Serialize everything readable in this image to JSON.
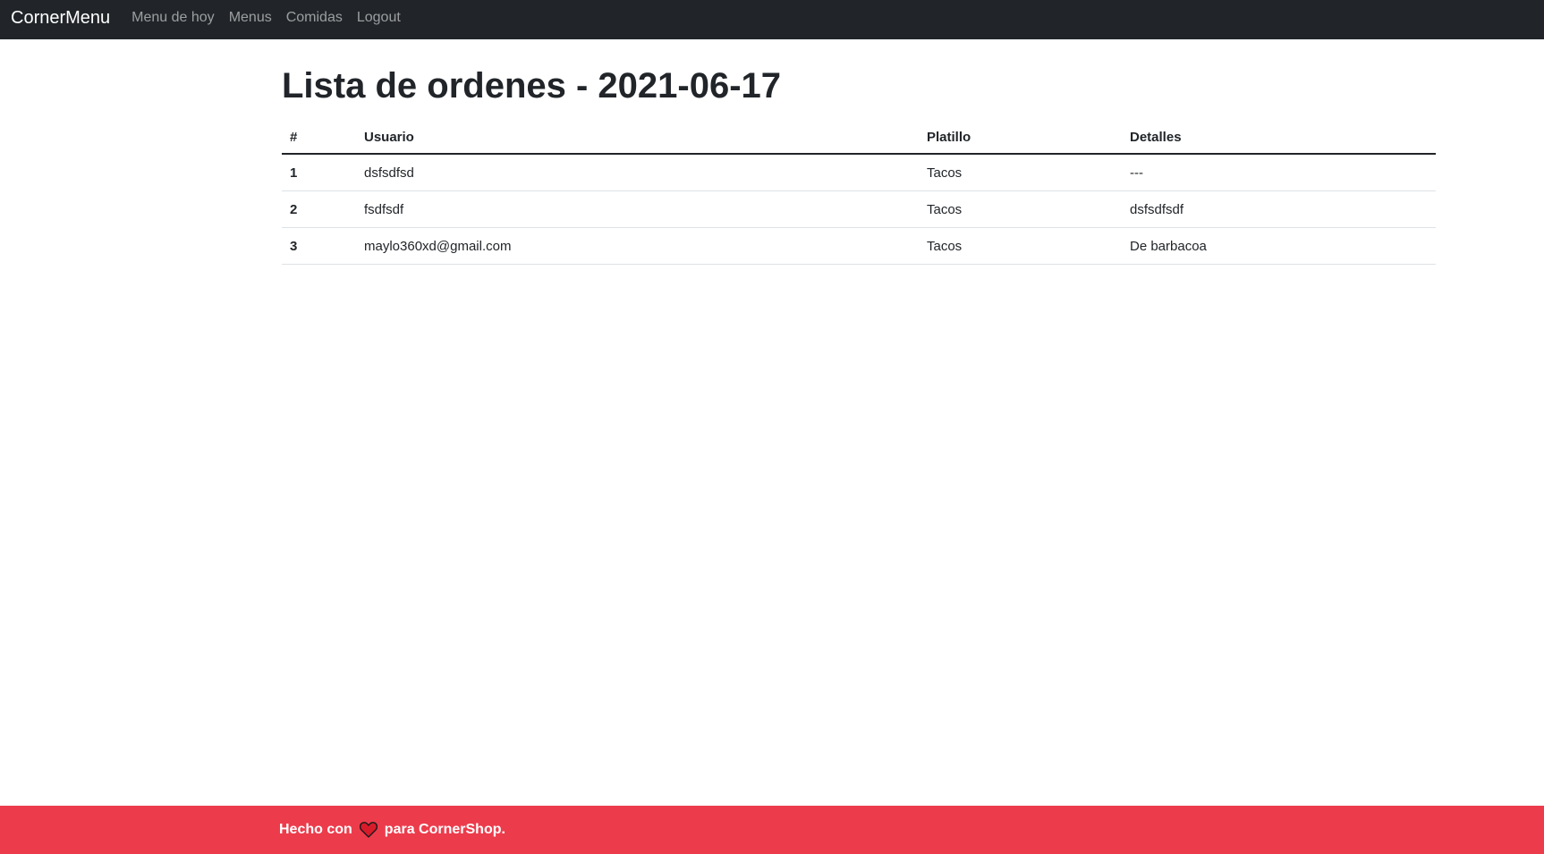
{
  "navbar": {
    "brand": "CornerMenu",
    "links": [
      "Menu de hoy",
      "Menus",
      "Comidas",
      "Logout"
    ]
  },
  "page": {
    "title": "Lista de ordenes - 2021-06-17"
  },
  "table": {
    "headers": [
      "#",
      "Usuario",
      "Platillo",
      "Detalles"
    ],
    "rows": [
      {
        "num": "1",
        "usuario": "dsfsdfsd",
        "platillo": "Tacos",
        "detalles": "---"
      },
      {
        "num": "2",
        "usuario": "fsdfsdf",
        "platillo": "Tacos",
        "detalles": "dsfsdfsdf"
      },
      {
        "num": "3",
        "usuario": "maylo360xd@gmail.com",
        "platillo": "Tacos",
        "detalles": "De barbacoa"
      }
    ]
  },
  "footer": {
    "before": "Hecho con",
    "icon": "heart-icon",
    "after": "para CornerShop.",
    "bg_color": "#ec3c4c"
  },
  "colors": {
    "navbar_bg": "#212529",
    "footer_bg": "#ec3c4c",
    "heart": "#d81b2a"
  }
}
